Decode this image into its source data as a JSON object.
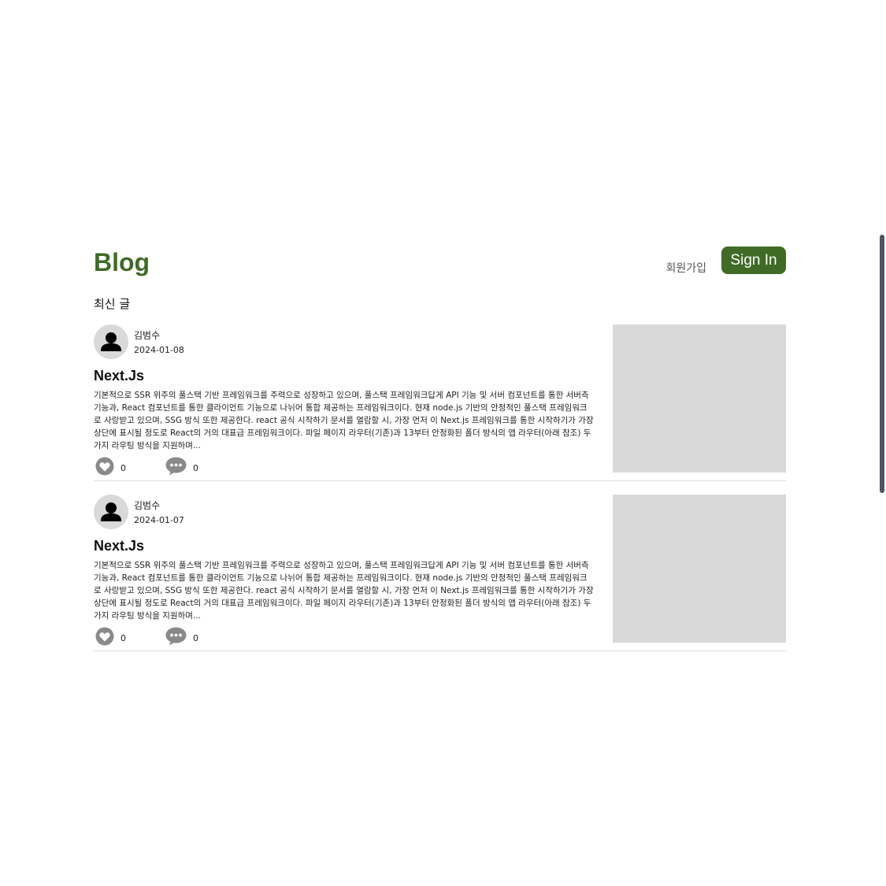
{
  "header": {
    "logo": "Blog",
    "signup_label": "회원가입",
    "signin_label": "Sign In"
  },
  "main": {
    "section_title": "최신 글"
  },
  "posts": [
    {
      "author": "김범수",
      "date": "2024-01-08",
      "title": "Next.Js",
      "excerpt": "기본적으로 SSR 위주의 풀스택 기반 프레임워크를 주력으로 성장하고 있으며, 풀스택 프레임워크답게 API 기능 및 서버 컴포넌트를 통한 서버측 기능과, React 컴포넌트를 통한 클라이언트 기능으로 나뉘어 통합 제공하는 프레임워크이다. 현재 node.js 기반의 안정적인 풀스택 프레임워크로 사랑받고 있으며, SSG 방식 또한 제공한다. react 공식 시작하기 문서를 열람할 시, 가장 먼저 이 Next.js 프레임워크를 통한 시작하기가 가장 상단에 표시될 정도로 React의 거의 대표급 프레임워크이다. 파일 페이지 라우터(기존)과 13부터 안정화된 폴더 방식의 앱 라우터(아래 참조) 두가지 라우팅 방식을 지원하며...",
      "likes": "0",
      "comments": "0"
    },
    {
      "author": "김범수",
      "date": "2024-01-07",
      "title": "Next.Js",
      "excerpt": "기본적으로 SSR 위주의 풀스택 기반 프레임워크를 주력으로 성장하고 있으며, 풀스택 프레임워크답게 API 기능 및 서버 컴포넌트를 통한 서버측 기능과, React 컴포넌트를 통한 클라이언트 기능으로 나뉘어 통합 제공하는 프레임워크이다. 현재 node.js 기반의 안정적인 풀스택 프레임워크로 사랑받고 있으며, SSG 방식 또한 제공한다. react 공식 시작하기 문서를 열람할 시, 가장 먼저 이 Next.js 프레임워크를 통한 시작하기가 가장 상단에 표시될 정도로 React의 거의 대표급 프레임워크이다. 파일 페이지 라우터(기존)과 13부터 안정화된 폴더 방식의 앱 라우터(아래 참조) 두가지 라우팅 방식을 지원하며...",
      "likes": "0",
      "comments": "0"
    }
  ],
  "icons": {
    "avatar": "user-icon",
    "like": "heart-icon",
    "comment": "chat-bubble-icon"
  },
  "colors": {
    "brand": "#3f6b26",
    "placeholder": "#d9d9d9",
    "icon_gray": "#8a8a8a"
  }
}
